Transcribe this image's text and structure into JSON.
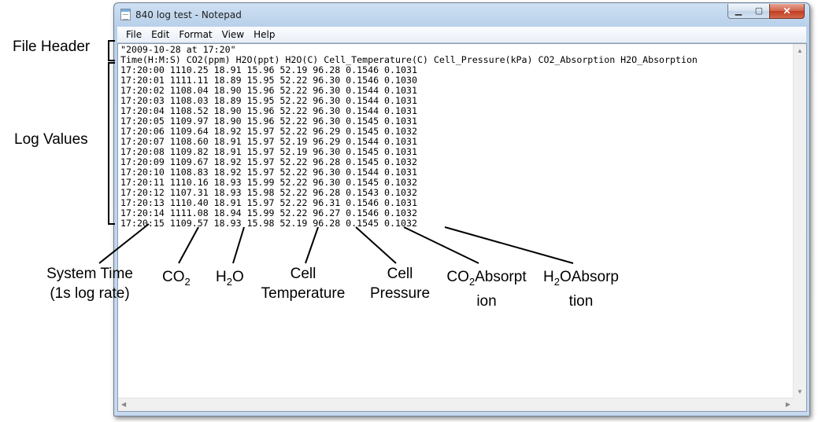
{
  "window": {
    "title": "840 log test - Notepad",
    "controls": {
      "minimize": "▁",
      "maximize": "▢",
      "close": "✕"
    }
  },
  "menu": [
    "File",
    "Edit",
    "Format",
    "View",
    "Help"
  ],
  "file": {
    "header_line": "\"2009-10-28 at 17:20\"",
    "column_line": "Time(H:M:S) CO2(ppm) H2O(ppt) H2O(C) Cell_Temperature(C) Cell_Pressure(kPa) CO2_Absorption H2O_Absorption",
    "rows": [
      "17:20:00 1110.25 18.91 15.96 52.19 96.28 0.1546 0.1031",
      "17:20:01 1111.11 18.89 15.95 52.22 96.30 0.1546 0.1030",
      "17:20:02 1108.04 18.90 15.96 52.22 96.30 0.1544 0.1031",
      "17:20:03 1108.03 18.89 15.95 52.22 96.30 0.1544 0.1031",
      "17:20:04 1108.52 18.90 15.96 52.22 96.30 0.1544 0.1031",
      "17:20:05 1109.97 18.90 15.96 52.22 96.30 0.1545 0.1031",
      "17:20:06 1109.64 18.92 15.97 52.22 96.29 0.1545 0.1032",
      "17:20:07 1108.60 18.91 15.97 52.19 96.29 0.1544 0.1031",
      "17:20:08 1109.82 18.91 15.97 52.19 96.30 0.1545 0.1031",
      "17:20:09 1109.67 18.92 15.97 52.22 96.28 0.1545 0.1032",
      "17:20:10 1108.83 18.92 15.97 52.22 96.30 0.1544 0.1031",
      "17:20:11 1110.16 18.93 15.99 52.22 96.30 0.1545 0.1032",
      "17:20:12 1107.31 18.93 15.98 52.22 96.28 0.1543 0.1032",
      "17:20:13 1110.40 18.91 15.97 52.22 96.31 0.1546 0.1031",
      "17:20:14 1111.08 18.94 15.99 52.22 96.27 0.1546 0.1032",
      "17:20:15 1109.57 18.93 15.98 52.19 96.28 0.1545 0.1032"
    ]
  },
  "annotations": {
    "file_header": "File Header",
    "log_values": "Log Values",
    "system_time": [
      "System Time",
      "(1s log rate)"
    ],
    "co2": {
      "main": "CO",
      "sub": "2"
    },
    "h2o": {
      "a": "H",
      "sub": "2",
      "b": "O"
    },
    "cell_temperature": [
      "Cell",
      "Temperature"
    ],
    "cell_pressure": [
      "Cell",
      "Pressure"
    ],
    "co2_absorption": {
      "a": "CO",
      "sub": "2",
      "b": "Absorpt",
      "line2": "ion"
    },
    "h2o_absorption": {
      "a": "H",
      "sub": "2",
      "b": "OAbsorp",
      "line2": "tion"
    }
  }
}
